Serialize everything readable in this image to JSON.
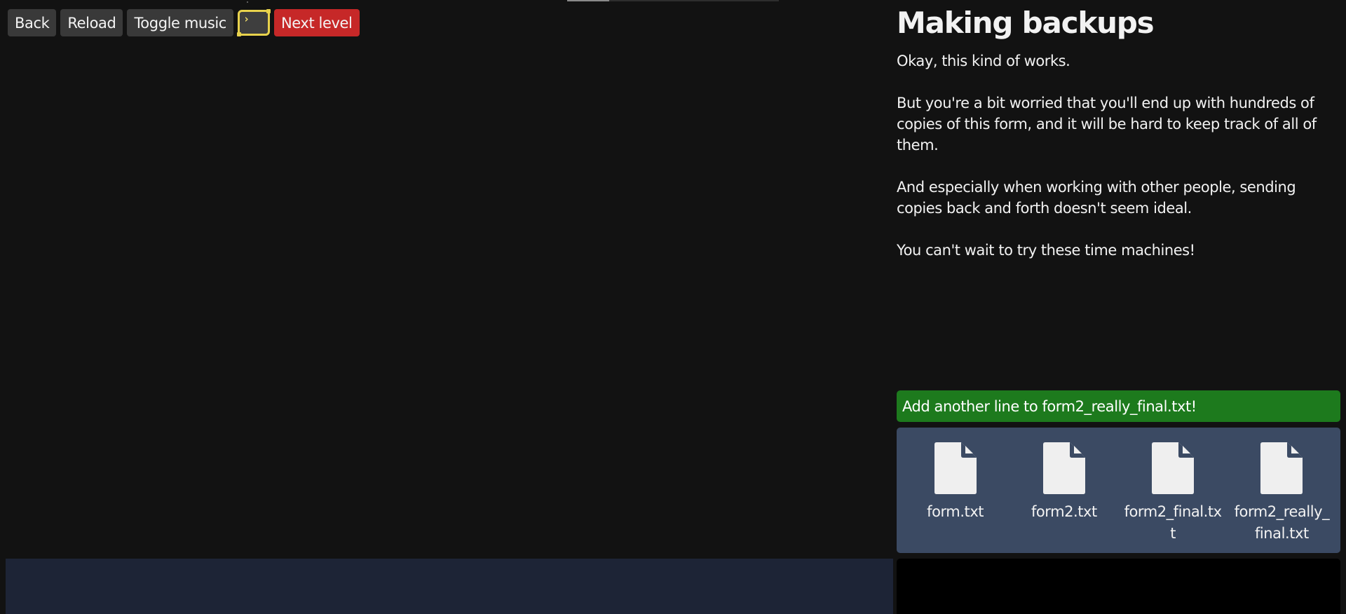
{
  "toolbar": {
    "back": "Back",
    "reload": "Reload",
    "toggle_music": "Toggle music",
    "terminal_prompt": "›",
    "next_level": "Next level"
  },
  "level": {
    "title": "Making backups",
    "paragraphs": [
      "Okay, this kind of works.",
      "But you're a bit worried that you'll end up with hundreds of copies of this form, and it will be hard to keep track of all of them.",
      "And especially when working with other people, sending copies back and forth doesn't seem ideal.",
      "You can't wait to try these time machines!"
    ]
  },
  "task": {
    "text": "Add another line to form2_really_final.txt!"
  },
  "files": [
    {
      "name": "form.txt",
      "icon": "file-icon"
    },
    {
      "name": "form2.txt",
      "icon": "file-icon"
    },
    {
      "name": "form2_final.txt",
      "icon": "file-icon"
    },
    {
      "name": "form2_really_final.txt",
      "icon": "file-icon"
    }
  ],
  "colors": {
    "background": "#121212",
    "button": "#393939",
    "next_button": "#c62828",
    "task_bg": "#1d7a1d",
    "files_bg": "#3b4a63",
    "graph_panel": "#1d2436",
    "terminal_bg": "#000000",
    "accent_yellow": "#e8d24c"
  }
}
